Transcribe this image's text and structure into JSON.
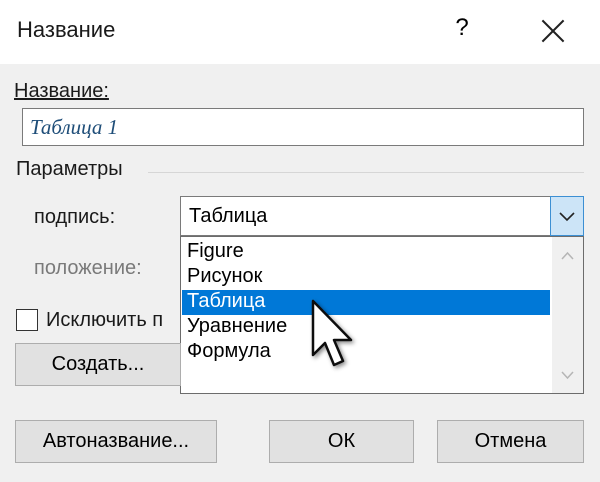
{
  "window": {
    "title": "Название",
    "help": "?"
  },
  "caption": {
    "label": "Название:",
    "value": "Таблица 1"
  },
  "options": {
    "group_label": "Параметры",
    "label_field": {
      "label": "подпись:",
      "value": "Таблица"
    },
    "position_label": "положение:",
    "exclude_label": "Исключить п",
    "create_button": "Создать..."
  },
  "dropdown": {
    "items": [
      "Figure",
      "Рисунок",
      "Таблица",
      "Уравнение",
      "Формула"
    ],
    "selected_index": 2
  },
  "footer": {
    "auto_button": "Автоназвание...",
    "ok_button": "ОК",
    "cancel_button": "Отмена"
  },
  "colors": {
    "accent": "#0078d7",
    "caption_text": "#1f4e79",
    "dialog_bg": "#f0f0f0"
  },
  "icons": [
    "close-icon",
    "chevron-down-icon",
    "scroll-up-icon",
    "scroll-down-icon",
    "mouse-cursor-icon"
  ]
}
